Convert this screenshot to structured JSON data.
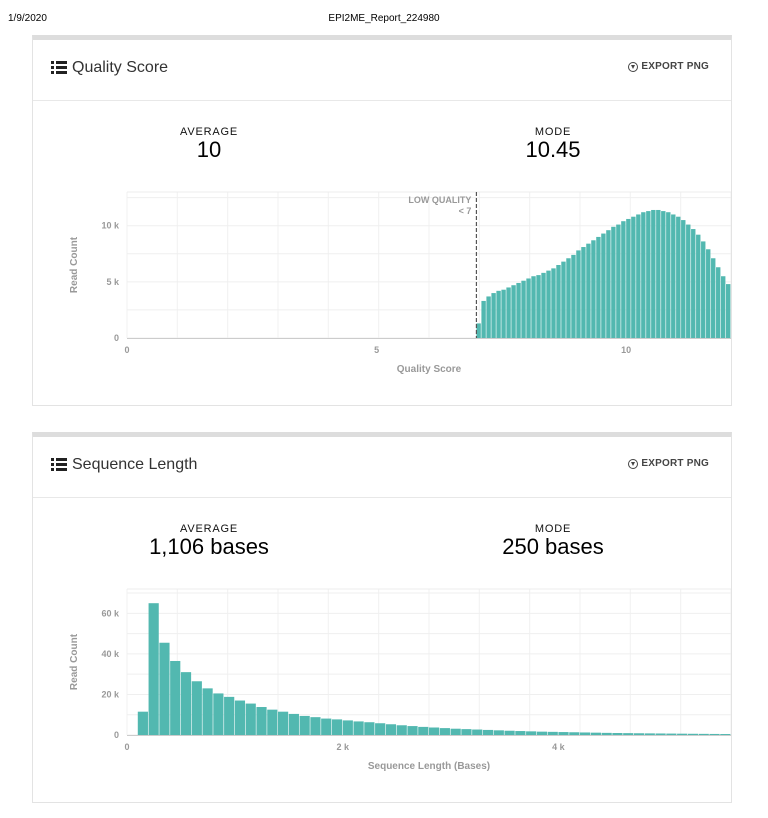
{
  "print_header": {
    "date": "1/9/2020",
    "title": "EPI2ME_Report_224980"
  },
  "panels": [
    {
      "title": "Quality Score",
      "export_label": "EXPORT PNG",
      "stats": [
        {
          "label": "AVERAGE",
          "value": "10"
        },
        {
          "label": "MODE",
          "value": "10.45"
        }
      ]
    },
    {
      "title": "Sequence Length",
      "export_label": "EXPORT PNG",
      "stats": [
        {
          "label": "AVERAGE",
          "value": "1,106 bases"
        },
        {
          "label": "MODE",
          "value": "250 bases"
        }
      ]
    }
  ],
  "chart_data": [
    {
      "type": "bar",
      "title": "",
      "xlabel": "Quality Score",
      "ylabel": "Read Count",
      "xlim": [
        0,
        12.1
      ],
      "ylim": [
        0,
        13000
      ],
      "x_ticks": [
        0,
        5,
        10
      ],
      "x_tick_labels": [
        "0",
        "5",
        "10"
      ],
      "y_ticks": [
        0,
        5000,
        10000
      ],
      "y_tick_labels": [
        "0",
        "5 k",
        "10 k"
      ],
      "bin_width": 0.1,
      "color": "#52b8b0",
      "annotation": {
        "x": 7,
        "line1": "LOW QUALITY",
        "line2": "< 7"
      },
      "bin_starts": [
        7.0,
        7.1,
        7.2,
        7.3,
        7.4,
        7.5,
        7.6,
        7.7,
        7.8,
        7.9,
        8.0,
        8.1,
        8.2,
        8.3,
        8.4,
        8.5,
        8.6,
        8.7,
        8.8,
        8.9,
        9.0,
        9.1,
        9.2,
        9.3,
        9.4,
        9.5,
        9.6,
        9.7,
        9.8,
        9.9,
        10.0,
        10.1,
        10.2,
        10.3,
        10.4,
        10.5,
        10.6,
        10.7,
        10.8,
        10.9,
        11.0,
        11.1,
        11.2,
        11.3,
        11.4,
        11.5,
        11.6,
        11.7,
        11.8,
        11.9,
        12.0
      ],
      "values": [
        1300,
        3300,
        3700,
        4000,
        4200,
        4300,
        4500,
        4700,
        4900,
        5100,
        5300,
        5500,
        5600,
        5800,
        6000,
        6200,
        6500,
        6800,
        7100,
        7400,
        7800,
        8100,
        8400,
        8700,
        9000,
        9300,
        9600,
        9900,
        10100,
        10400,
        10600,
        10800,
        11000,
        11200,
        11300,
        11400,
        11400,
        11300,
        11200,
        11000,
        10800,
        10500,
        10100,
        9700,
        9200,
        8600,
        7900,
        7100,
        6300,
        5500,
        4800
      ]
    },
    {
      "type": "bar",
      "title": "",
      "xlabel": "Sequence Length (Bases)",
      "ylabel": "Read Count",
      "xlim": [
        0,
        5600
      ],
      "ylim": [
        0,
        72000
      ],
      "x_ticks": [
        0,
        2000,
        4000
      ],
      "x_tick_labels": [
        "0",
        "2 k",
        "4 k"
      ],
      "y_ticks": [
        0,
        20000,
        40000,
        60000
      ],
      "y_tick_labels": [
        "0",
        "20 k",
        "40 k",
        "60 k"
      ],
      "bin_width": 100,
      "color": "#52b8b0",
      "bin_starts": [
        0,
        100,
        200,
        300,
        400,
        500,
        600,
        700,
        800,
        900,
        1000,
        1100,
        1200,
        1300,
        1400,
        1500,
        1600,
        1700,
        1800,
        1900,
        2000,
        2100,
        2200,
        2300,
        2400,
        2500,
        2600,
        2700,
        2800,
        2900,
        3000,
        3100,
        3200,
        3300,
        3400,
        3500,
        3600,
        3700,
        3800,
        3900,
        4000,
        4100,
        4200,
        4300,
        4400,
        4500,
        4600,
        4700,
        4800,
        4900,
        5000,
        5100,
        5200,
        5300,
        5400,
        5500
      ],
      "values": [
        0,
        11500,
        65000,
        45500,
        36500,
        31000,
        26500,
        23000,
        20500,
        18800,
        17000,
        15500,
        13800,
        12500,
        11500,
        10400,
        9400,
        8800,
        8100,
        7700,
        7200,
        6700,
        6300,
        5800,
        5300,
        4800,
        4400,
        4000,
        3700,
        3400,
        3100,
        2900,
        2700,
        2500,
        2300,
        2100,
        1950,
        1800,
        1650,
        1550,
        1450,
        1350,
        1250,
        1150,
        1050,
        980,
        920,
        860,
        800,
        750,
        700,
        650,
        600,
        560,
        520,
        480
      ]
    }
  ]
}
